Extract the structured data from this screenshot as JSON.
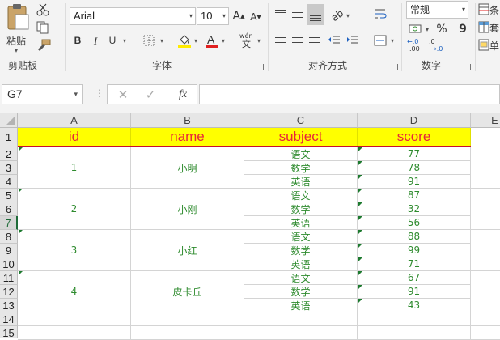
{
  "ribbon": {
    "clipboard": {
      "paste_label": "粘贴",
      "group_label": "剪贴板"
    },
    "font": {
      "name": "Arial",
      "size": "10",
      "group_label": "字体",
      "bold": "B",
      "italic": "I",
      "underline": "U",
      "wen": "wén",
      "font_color": "#e02020",
      "fill_color": "#ffeb00"
    },
    "alignment": {
      "group_label": "对齐方式"
    },
    "number": {
      "format": "常规",
      "percent": "%",
      "comma": "9",
      "inc_decimal": ".00",
      "dec_decimal": ".0",
      "group_label": "数字"
    },
    "cells": {
      "labels": [
        "条",
        "套",
        "单"
      ]
    }
  },
  "formula_bar": {
    "name_box": "G7",
    "fx": "fx",
    "content": ""
  },
  "columns": [
    "A",
    "B",
    "C",
    "D",
    "E"
  ],
  "rows": [
    "1",
    "2",
    "3",
    "4",
    "5",
    "6",
    "7",
    "8",
    "9",
    "10",
    "11",
    "12",
    "13",
    "14",
    "15"
  ],
  "sheet": {
    "headers": [
      "id",
      "name",
      "subject",
      "score"
    ],
    "groups": [
      {
        "id": "1",
        "name": "小明",
        "records": [
          {
            "subject": "语文",
            "score": "77"
          },
          {
            "subject": "数学",
            "score": "78"
          },
          {
            "subject": "英语",
            "score": "91"
          }
        ]
      },
      {
        "id": "2",
        "name": "小刚",
        "records": [
          {
            "subject": "语文",
            "score": "87"
          },
          {
            "subject": "数学",
            "score": "32"
          },
          {
            "subject": "英语",
            "score": "56"
          }
        ]
      },
      {
        "id": "3",
        "name": "小红",
        "records": [
          {
            "subject": "语文",
            "score": "88"
          },
          {
            "subject": "数学",
            "score": "99"
          },
          {
            "subject": "英语",
            "score": "71"
          }
        ]
      },
      {
        "id": "4",
        "name": "皮卡丘",
        "records": [
          {
            "subject": "语文",
            "score": "67"
          },
          {
            "subject": "数学",
            "score": "91"
          },
          {
            "subject": "英语",
            "score": "43"
          }
        ]
      }
    ]
  },
  "colors": {
    "header_fill": "#ffff00",
    "header_text": "#e8253a",
    "cell_text": "#2e8b2e",
    "error_triangle": "#1d7a2f"
  }
}
